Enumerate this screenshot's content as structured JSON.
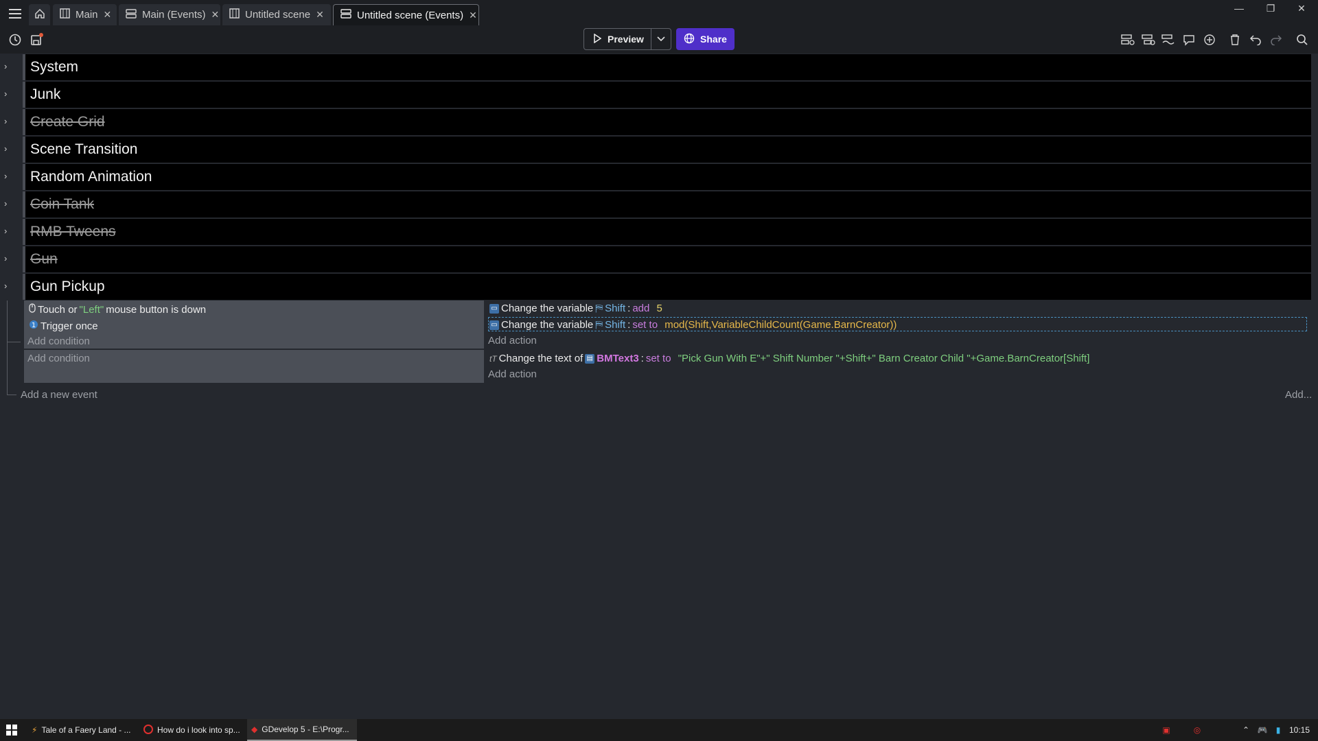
{
  "tabs": [
    {
      "label": "Main",
      "icon": "scene-icon",
      "active": false
    },
    {
      "label": "Main (Events)",
      "icon": "events-icon",
      "active": false
    },
    {
      "label": "Untitled scene",
      "icon": "scene-icon",
      "active": false
    },
    {
      "label": "Untitled scene (Events)",
      "icon": "events-icon",
      "active": true
    }
  ],
  "toolbar": {
    "preview_label": "Preview",
    "share_label": "Share"
  },
  "groups": [
    {
      "label": "System",
      "disabled": false
    },
    {
      "label": "Junk",
      "disabled": false
    },
    {
      "label": "Create Grid",
      "disabled": true
    },
    {
      "label": "Scene Transition",
      "disabled": false
    },
    {
      "label": "Random Animation",
      "disabled": false
    },
    {
      "label": "Coin Tank",
      "disabled": true
    },
    {
      "label": "RMB Tweens",
      "disabled": true
    },
    {
      "label": "Gun",
      "disabled": true
    },
    {
      "label": "Gun Pickup",
      "disabled": false
    }
  ],
  "event1": {
    "conditions": [
      {
        "pre": "Touch or ",
        "str": "\"Left\"",
        "post": " mouse button is down"
      },
      {
        "text": "Trigger once"
      }
    ],
    "add_condition": "Add condition",
    "actions": [
      {
        "pre": "Change the variable ",
        "var": "Shift",
        "sep": ": ",
        "kw": "add",
        "value": "5"
      },
      {
        "pre": "Change the variable ",
        "var": "Shift",
        "sep": ": ",
        "kw": "set to",
        "value": "mod(Shift,VariableChildCount(Game.BarnCreator))"
      }
    ],
    "add_action": "Add action"
  },
  "event2": {
    "add_condition": "Add condition",
    "action": {
      "pre": "Change the text of ",
      "obj": "BMText3",
      "sep": ": ",
      "kw": "set to",
      "value": "\"Pick Gun With E\"+\" Shift Number \"+Shift+\" Barn Creator Child \"+Game.BarnCreator[Shift]"
    },
    "add_action": "Add action"
  },
  "add_new_event": "Add a new event",
  "add_more": "Add...",
  "taskbar": {
    "items": [
      {
        "label": "Tale of a Faery Land - ...",
        "icon": "game-icon",
        "active": false
      },
      {
        "label": "How do i look into sp...",
        "icon": "opera-icon",
        "active": false
      },
      {
        "label": "GDevelop 5 - E:\\Progr...",
        "icon": "gdevelop-icon",
        "active": true
      }
    ],
    "clock": "10:15"
  },
  "colors": {
    "accent": "#4f2fc9",
    "background": "#25282e",
    "group_bar": "#000000",
    "event_panel": "#4b4f57",
    "string": "#7fd07f",
    "number": "#e6d36a",
    "keyword": "#c97dde"
  }
}
